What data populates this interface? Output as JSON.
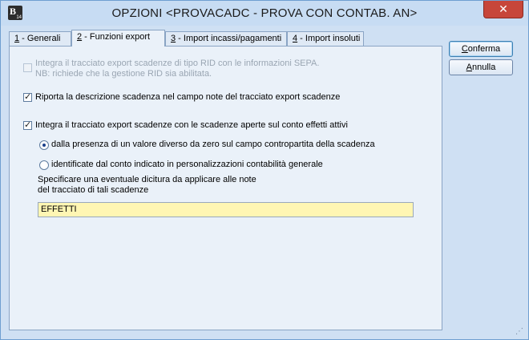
{
  "window": {
    "title": "OPZIONI <PROVACADC - PROVA CON CONTAB. AN>",
    "icon_letter": "B",
    "icon_number": "14",
    "close_glyph": "✕"
  },
  "tabs": [
    {
      "key": "1",
      "label": " - Generali",
      "active": false
    },
    {
      "key": "2",
      "label": " - Funzioni export",
      "active": true
    },
    {
      "key": "3",
      "label": " - Import incassi/pagamenti",
      "active": false
    },
    {
      "key": "4",
      "label": " - Import insoluti",
      "active": false
    }
  ],
  "panel": {
    "sepa_option": {
      "line1": "Integra il tracciato export scadenze di tipo RID con le informazioni SEPA.",
      "line2": "NB: richiede che la gestione RID sia abilitata.",
      "checked": false,
      "enabled": false
    },
    "note_option": {
      "label": "Riporta la descrizione scadenza nel campo note del tracciato export scadenze",
      "checked": true
    },
    "effetti_option": {
      "label": "Integra il tracciato export scadenze con le scadenze aperte sul conto effetti attivi",
      "checked": true
    },
    "radio_contropartita": {
      "label": "dalla presenza di un valore diverso da zero sul campo contropartita della scadenza",
      "selected": true
    },
    "radio_conto": {
      "label": "identificate dal conto indicato in personalizzazioni contabilità generale",
      "selected": false
    },
    "dicitura_label_line1": "Specificare una eventuale dicitura da applicare alle note",
    "dicitura_label_line2": "del tracciato di tali scadenze",
    "dicitura_value": "EFFETTI"
  },
  "buttons": {
    "confirm_key": "C",
    "confirm_rest": "onferma",
    "cancel_key": "A",
    "cancel_rest": "nnulla"
  },
  "colors": {
    "field_highlight": "#fff6b3",
    "window_bg": "#cfe0f3",
    "close_red": "#c7463a"
  }
}
